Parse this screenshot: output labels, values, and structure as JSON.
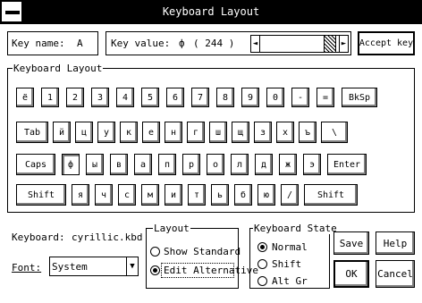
{
  "window": {
    "title": "Keyboard Layout"
  },
  "top": {
    "key_name_label": "Key name:",
    "key_name_value": "A",
    "key_value_label": "Key value:",
    "key_value_char": "ф",
    "key_value_code": "( 244 )",
    "scroll_left": "◄",
    "scroll_right": "►",
    "accept_button": "Accept key"
  },
  "keyboard": {
    "group_title": "Keyboard Layout",
    "rows": [
      [
        "ё",
        "1",
        "2",
        "3",
        "4",
        "5",
        "6",
        "7",
        "8",
        "9",
        "0",
        "-",
        "=",
        "BkSp"
      ],
      [
        "Tab",
        "й",
        "ц",
        "у",
        "к",
        "е",
        "н",
        "г",
        "ш",
        "щ",
        "з",
        "х",
        "ъ",
        "\\"
      ],
      [
        "Caps",
        "ф",
        "ы",
        "в",
        "а",
        "п",
        "р",
        "о",
        "л",
        "д",
        "ж",
        "э",
        "Enter"
      ],
      [
        "Shift",
        "я",
        "ч",
        "с",
        "м",
        "и",
        "т",
        "ь",
        "б",
        "ю",
        "/",
        "Shift"
      ]
    ],
    "selected_key": "ф"
  },
  "bottom": {
    "keyboard_label": "Keyboard:",
    "keyboard_file": "cyrillic.kbd",
    "font_label": "Font:",
    "font_value": "System",
    "font_drop": "▼",
    "layout_group": "Layout",
    "layout_options": [
      "Show Standard",
      "Edit Alternative"
    ],
    "layout_selected": 1,
    "state_group": "Keyboard State",
    "state_options": [
      "Normal",
      "Shift",
      "Alt Gr"
    ],
    "state_selected": 0,
    "save_button": "Save",
    "help_button": "Help",
    "ok_button": "OK",
    "cancel_button": "Cancel"
  }
}
